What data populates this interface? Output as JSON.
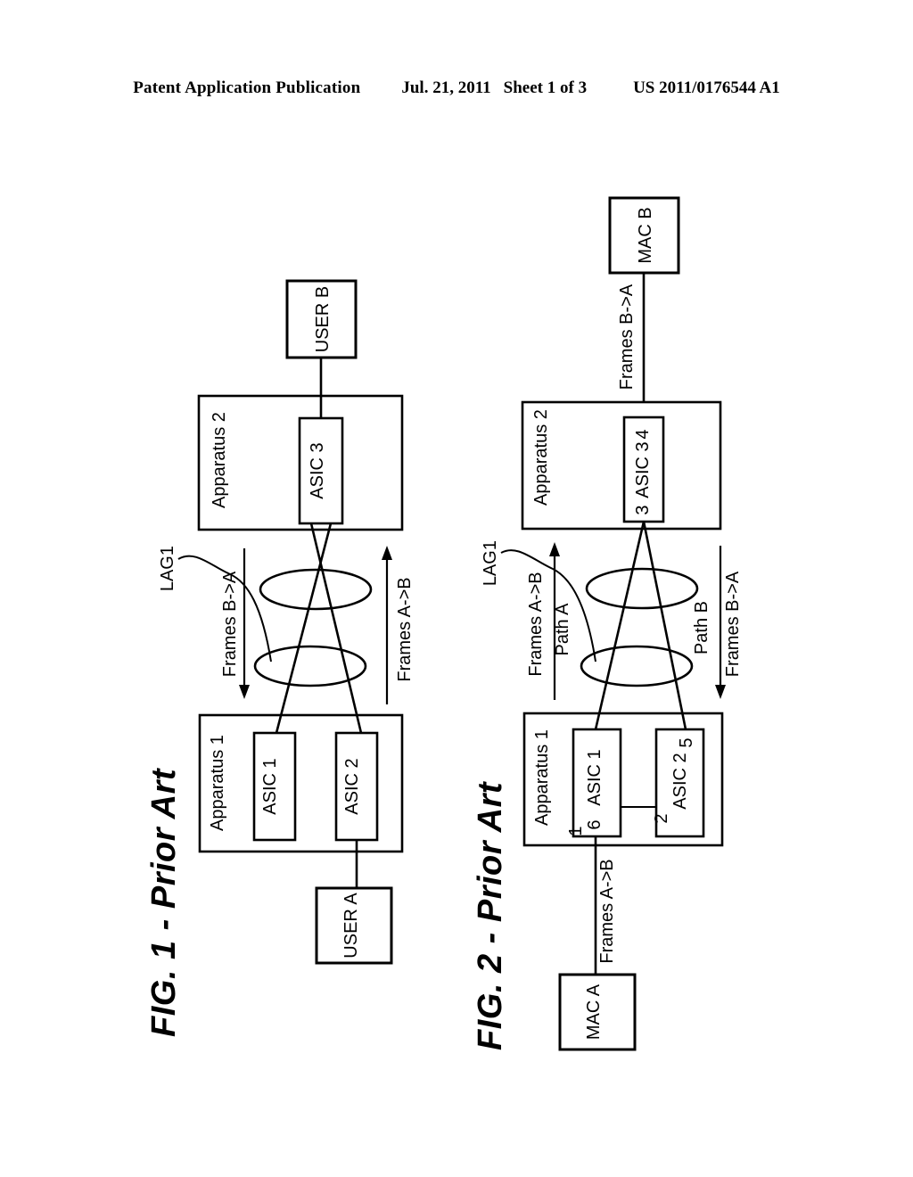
{
  "header": {
    "publication": "Patent Application Publication",
    "date": "Jul. 21, 2011",
    "sheet": "Sheet 1 of 3",
    "patent_number": "US 2011/0176544 A1"
  },
  "figures": [
    {
      "id": "fig1",
      "caption": "FIG. 1 - Prior Art",
      "nodes": {
        "apparatus_top": "Apparatus 2",
        "apparatus_bottom": "Apparatus 1",
        "asic_top": "ASIC 3",
        "asic_bottom_left": "ASIC 1",
        "asic_bottom_right": "ASIC 2",
        "endpoint_top": "USER B",
        "endpoint_bottom": "USER A"
      },
      "annotations": {
        "lag": "LAG1",
        "flow_left": "Frames B->A",
        "flow_right": "Frames A->B"
      }
    },
    {
      "id": "fig2",
      "caption": "FIG. 2 - Prior Art",
      "nodes": {
        "apparatus_top": "Apparatus 2",
        "apparatus_bottom": "Apparatus 1",
        "asic_top": "ASIC 3",
        "asic_bottom_left": "ASIC 1",
        "asic_bottom_right": "ASIC 2",
        "endpoint_top": "MAC B",
        "endpoint_bottom": "MAC A"
      },
      "annotations": {
        "lag": "LAG1",
        "flow_left": "Frames A->B",
        "path_left": "Path A",
        "flow_right": "Frames B->A",
        "path_right": "Path B",
        "link_top": "Frames B->A",
        "link_bottom": "Frames A->B"
      },
      "reference_numerals": {
        "asic_top_left": "3",
        "asic_top_right": "4",
        "asic_bottom_left_inner": "6",
        "asic_bottom_left_outer": "1",
        "asic_bottom_right_inner": "2",
        "asic_bottom_right_outer": "5"
      }
    }
  ],
  "colors": {
    "ink": "#000000",
    "paper": "#ffffff"
  }
}
